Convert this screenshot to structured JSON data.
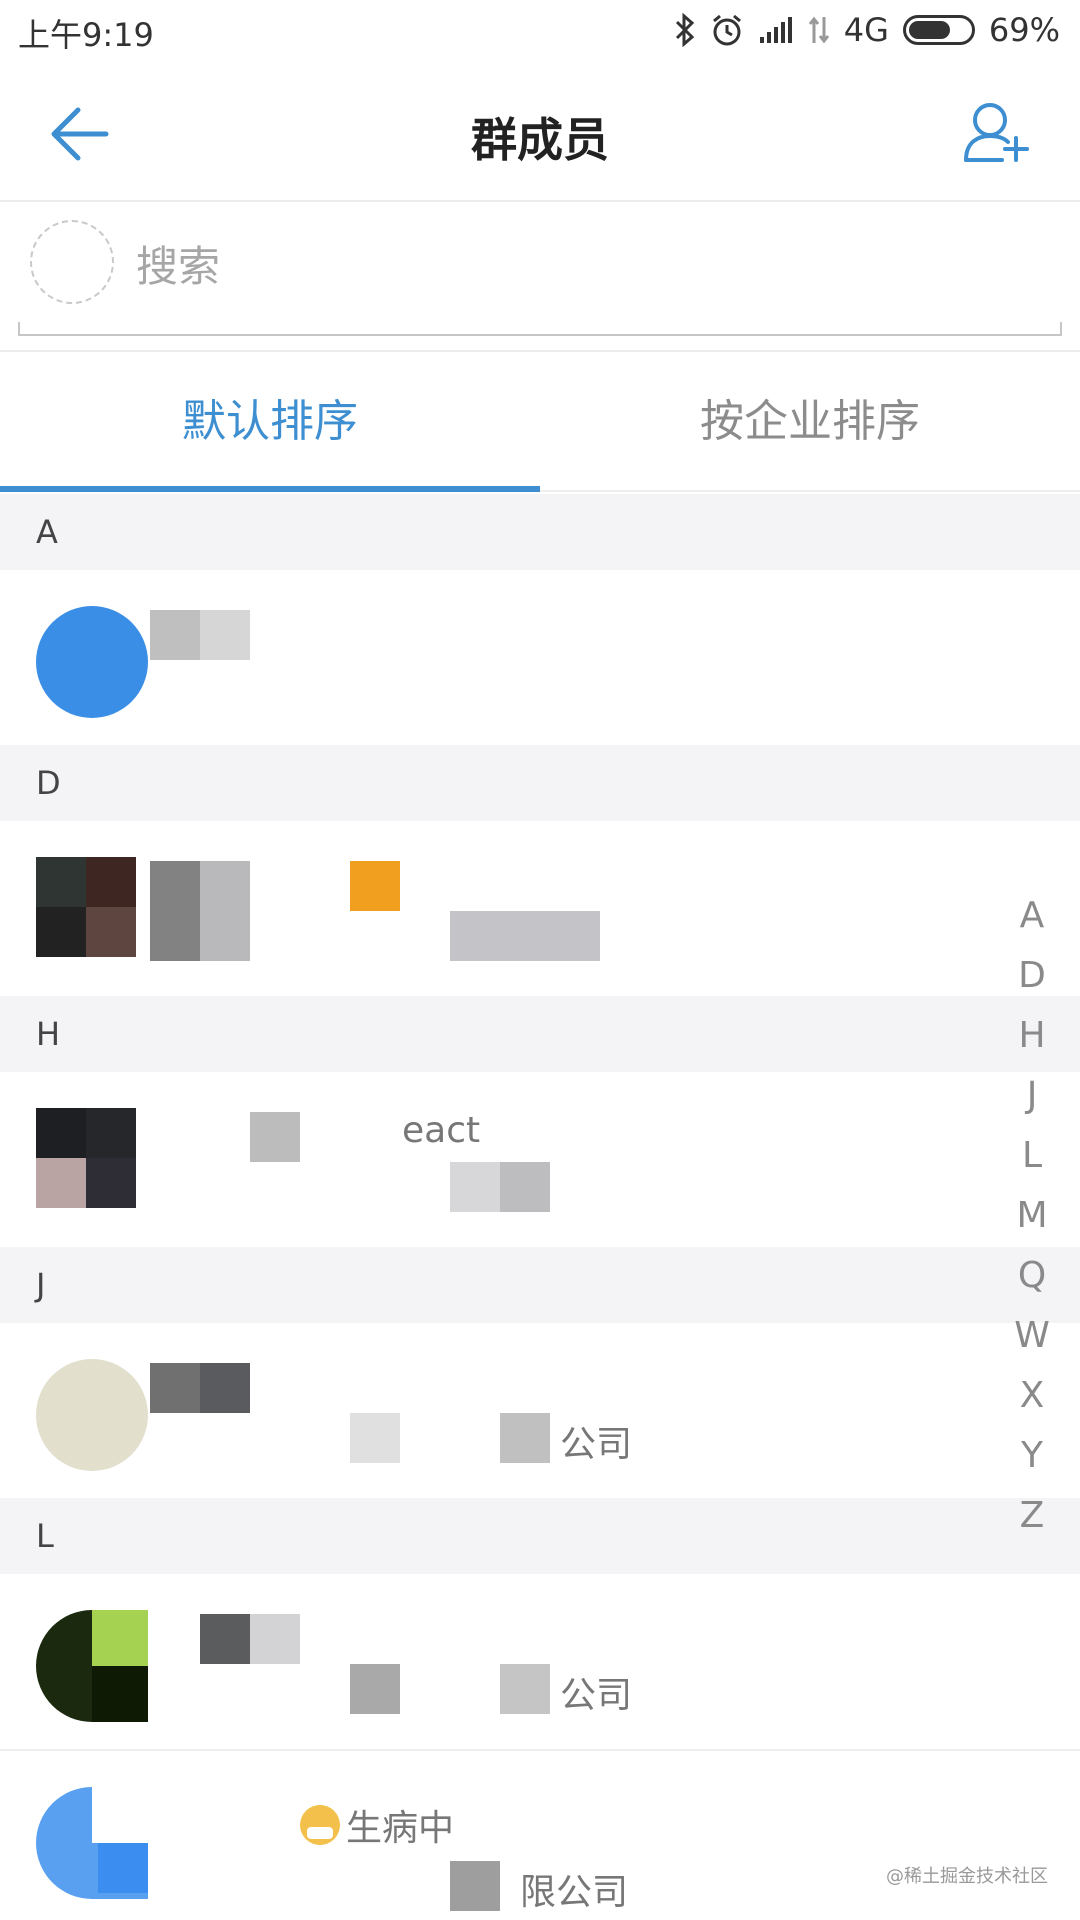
{
  "status_bar": {
    "time": "上午9:19",
    "network": "4G",
    "battery": "69%",
    "battery_level": 0.69,
    "icons": [
      "bluetooth-icon",
      "alarm-icon",
      "signal-icon",
      "data-icon",
      "battery-icon"
    ]
  },
  "header": {
    "title": "群成员",
    "back_icon": "arrow-left-icon",
    "add_icon": "add-user-icon",
    "accent": "#3d8fd1"
  },
  "search": {
    "placeholder": "搜索"
  },
  "tabs": [
    {
      "label": "默认排序",
      "active": true
    },
    {
      "label": "按企业排序",
      "active": false
    }
  ],
  "sections": [
    {
      "letter": "A"
    },
    {
      "letter": "D"
    },
    {
      "letter": "H",
      "snippet": "eact"
    },
    {
      "letter": "J",
      "snippet": "公司"
    },
    {
      "letter": "L",
      "snippet": "公司",
      "extra_status": "生病中",
      "extra_snippet": "限公司"
    }
  ],
  "index_bar": [
    "A",
    "D",
    "H",
    "J",
    "L",
    "M",
    "Q",
    "W",
    "X",
    "Y",
    "Z"
  ],
  "watermark": "@稀土掘金技术社区"
}
